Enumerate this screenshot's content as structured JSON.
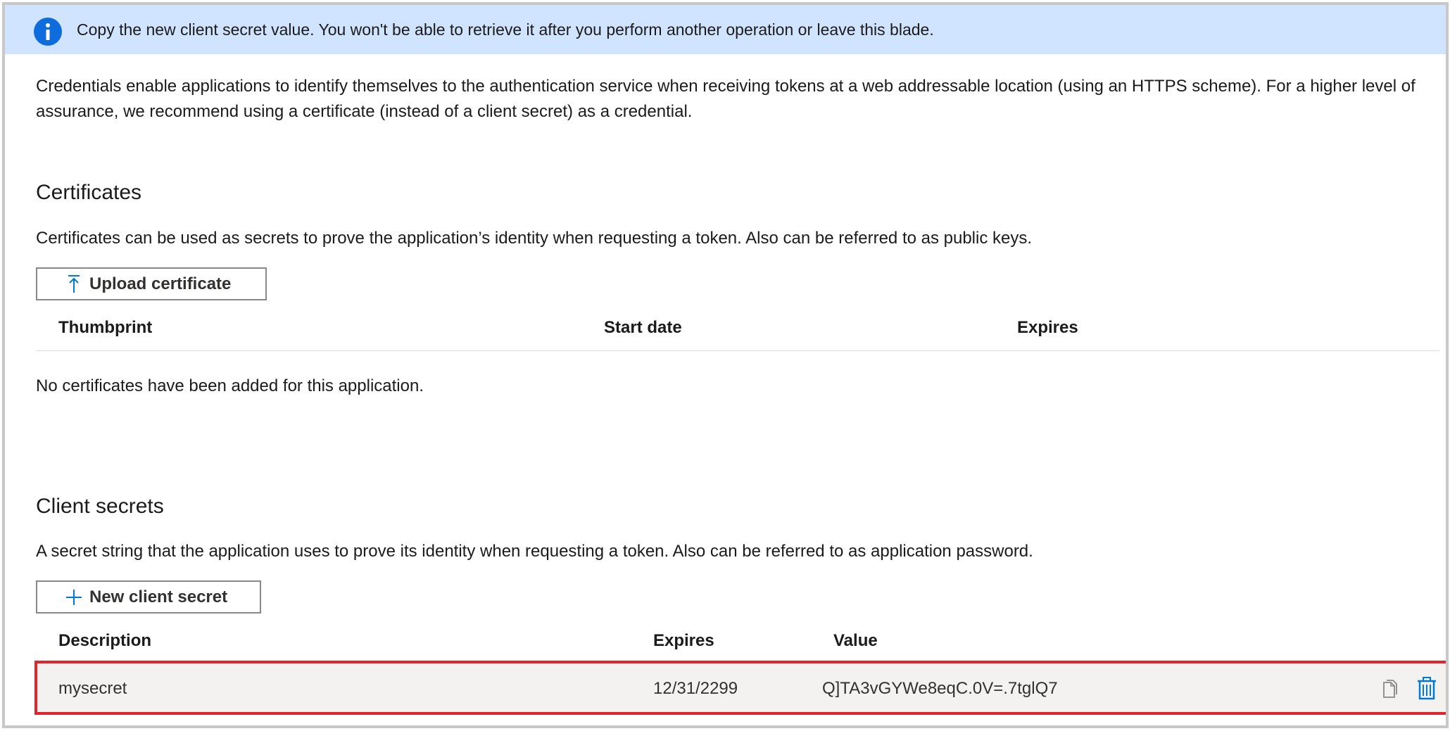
{
  "banner": {
    "icon": "info-icon",
    "message": "Copy the new client secret value. You won't be able to retrieve it after you perform another operation or leave this blade."
  },
  "intro": {
    "text": "Credentials enable applications to identify themselves to the authentication service when receiving tokens at a web addressable location (using an HTTPS scheme). For a higher level of assurance, we recommend using a certificate (instead of a client secret) as a credential."
  },
  "certificates": {
    "title": "Certificates",
    "description": "Certificates can be used as secrets to prove the application’s identity when requesting a token. Also can be referred to as public keys.",
    "upload_button": {
      "icon": "upload-icon",
      "label": "Upload certificate"
    },
    "columns": [
      "Thumbprint",
      "Start date",
      "Expires"
    ],
    "empty_message": "No certificates have been added for this application."
  },
  "client_secrets": {
    "title": "Client secrets",
    "description": "A secret string that the application uses to prove its identity when requesting a token. Also can be referred to as application password.",
    "new_button": {
      "icon": "plus-icon",
      "label": "New client secret"
    },
    "columns": [
      "Description",
      "Expires",
      "Value"
    ],
    "rows": [
      {
        "description": "mysecret",
        "expires": "12/31/2299",
        "value": "Q]TA3vGYWe8eqC.0V=.7tglQ7",
        "actions": [
          "copy-icon",
          "delete-icon"
        ]
      }
    ]
  },
  "colors": {
    "banner_bg": "#d0e3ff",
    "info_icon": "#0f6cdc",
    "accent_blue": "#0078d4",
    "highlight_border": "#e3242b",
    "row_bg": "#f3f2f1"
  }
}
